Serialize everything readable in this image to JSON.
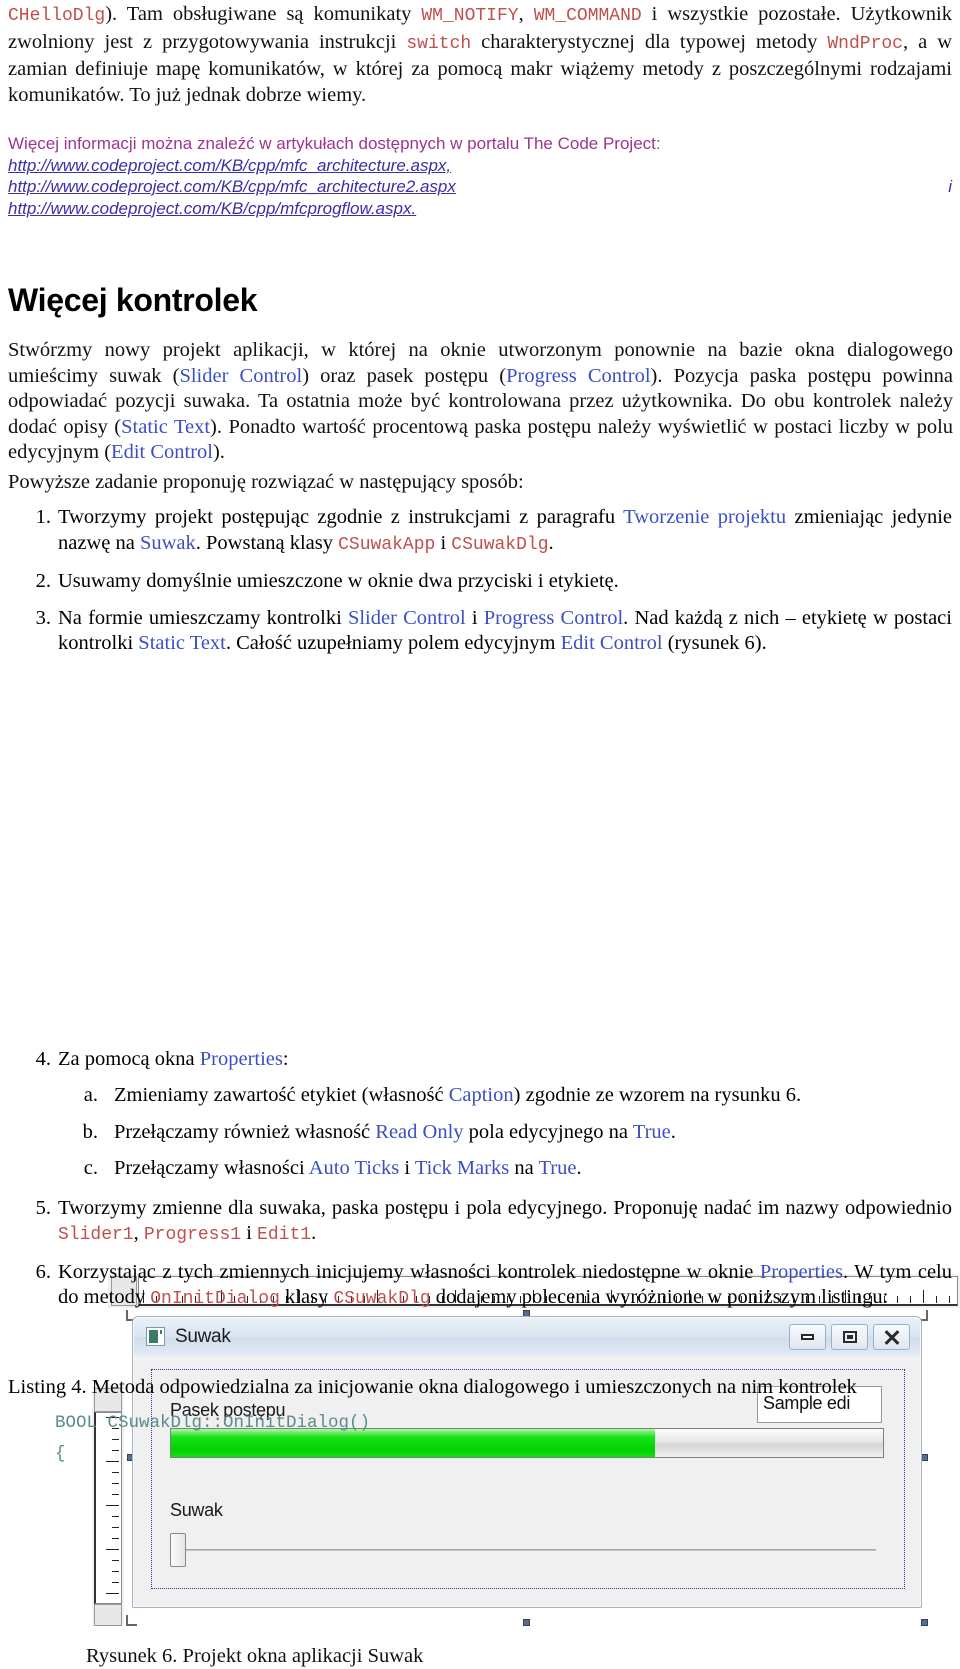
{
  "top_paragraph": {
    "seg1_code": "CHelloDlg",
    "seg2": "). Tam obsługiwane są komunikaty ",
    "seg3_code": "WM_NOTIFY",
    "seg4": ", ",
    "seg5_code": "WM_COMMAND",
    "seg6": " i wszystkie pozostałe. Użytkownik zwolniony jest z przygotowywania instrukcji ",
    "seg7_code": "switch",
    "seg8": " charakterystycznej dla typowej metody ",
    "seg9_code": "WndProc",
    "seg10": ", a w zamian definiuje mapę komunikatów, w której za pomocą makr wiążemy metody z poszczególnymi rodzajami komunikatów. To już jednak dobrze wiemy."
  },
  "info_block": {
    "lead": "Więcej informacji można znaleźć w artykułach dostępnych w portalu The Code Project:",
    "url1": "http://www.codeproject.com/KB/cpp/mfc_architecture.aspx,",
    "url2": "http://www.codeproject.com/KB/cpp/mfc_architecture2.aspx",
    "url2_trailing": "i",
    "url3": "http://www.codeproject.com/KB/cpp/mfcprogflow.aspx."
  },
  "heading": "Więcej kontrolek",
  "intro_paragraph": {
    "p1": "Stwórzmy nowy projekt aplikacji, w której na oknie utworzonym ponownie na bazie okna dialogowego umieścimy suwak (",
    "link1": "Slider Control",
    "p2": ") oraz pasek postępu (",
    "link2": "Progress Control",
    "p3": "). Pozycja paska postępu powinna odpowiadać pozycji suwaka. Ta ostatnia może być kontrolowana przez użytkownika. Do obu kontrolek należy dodać opisy (",
    "link3": "Static Text",
    "p4": "). Ponadto wartość procentową paska postępu należy wyświetlić w postaci liczby w polu edycyjnym (",
    "link4": "Edit Control",
    "p5": ")."
  },
  "propose_line": "Powyższe zadanie proponuję rozwiązać w następujący sposób:",
  "steps": [
    {
      "num": "1.",
      "p1": "Tworzymy projekt postępując zgodnie z instrukcjami z paragrafu ",
      "link1": "Tworzenie projektu",
      "p2": " zmieniając jedynie nazwę na ",
      "link2": "Suwak",
      "p3": ". Powstaną klasy ",
      "code1": "CSuwakApp",
      "p4": " i ",
      "code2": "CSuwakDlg",
      "p5": "."
    },
    {
      "num": "2.",
      "p1": "Usuwamy domyślnie umieszczone w oknie dwa przyciski i etykietę."
    },
    {
      "num": "3.",
      "p1": "Na formie umieszczamy kontrolki ",
      "link1": "Slider Control",
      "p2": " i ",
      "link2": "Progress Control",
      "p3": ". Nad każdą z nich – etykietę w postaci kontrolki ",
      "link3": "Static Text",
      "p4": ". Całość uzupełniamy polem edycyjnym ",
      "link4": "Edit Control",
      "p5": " (rysunek 6)."
    },
    {
      "num": "4.",
      "p1": "Za pomocą okna ",
      "link1": "Properties",
      "p2": ":",
      "sub": [
        {
          "num": "a.",
          "p1": "Zmieniamy zawartość etykiet (własność ",
          "link1": "Caption",
          "p2": ") zgodnie ze wzorem na rysunku 6."
        },
        {
          "num": "b.",
          "p1": "Przełączamy również własność ",
          "link1": "Read Only",
          "p2": " pola edycyjnego na ",
          "link2": "True",
          "p3": "."
        },
        {
          "num": "c.",
          "p1": "Przełączamy własności ",
          "link1": "Auto Ticks",
          "p2": " i ",
          "link2": "Tick Marks",
          "p3": " na ",
          "link3": "True",
          "p4": "."
        }
      ]
    },
    {
      "num": "5.",
      "p1": "Tworzymy zmienne dla suwaka, paska postępu i pola edycyjnego. Proponuję nadać im nazwy odpowiednio ",
      "code1": "Slider1",
      "p2": ", ",
      "code2": "Progress1",
      "p3": " i ",
      "code3": "Edit1",
      "p4": "."
    },
    {
      "num": "6.",
      "p1": "Korzystając z tych zmiennych inicjujemy własności kontrolek niedostępne w oknie ",
      "link1": "Properties",
      "p2": ". W tym celu do metody ",
      "code1": "OnInitDialog",
      "p3": " klasy ",
      "code2": "CSuwakDlg",
      "p4": " dodajemy polecenia wyróżnione w poniższym listingu:"
    }
  ],
  "figure": {
    "caption": "Rysunek 6. Projekt okna aplikacji Suwak",
    "dialog_title": "Suwak",
    "label_progress": "Pasek postępu",
    "label_slider": "Suwak",
    "edit_value": "Sample edi",
    "progress_percent": 68,
    "slider_position": 0,
    "window_buttons": [
      "minimize-icon",
      "maximize-icon",
      "close-icon"
    ],
    "app_icon": "app-icon"
  },
  "listing": {
    "caption": "Listing 4. Metoda odpowiedzialna za inicjowanie okna dialogowego i umieszczonych na nim kontrolek",
    "line1": "BOOL CSuwakDlg::OnInitDialog()",
    "line2": "{"
  },
  "colors": {
    "code_red": "#c0504d",
    "link_blue": "#3b4fc4",
    "info_magenta": "#a0348e",
    "url_violet": "#3a2fa8",
    "listing_teal": "#5b8c8c",
    "progress_green": "#00d200"
  }
}
